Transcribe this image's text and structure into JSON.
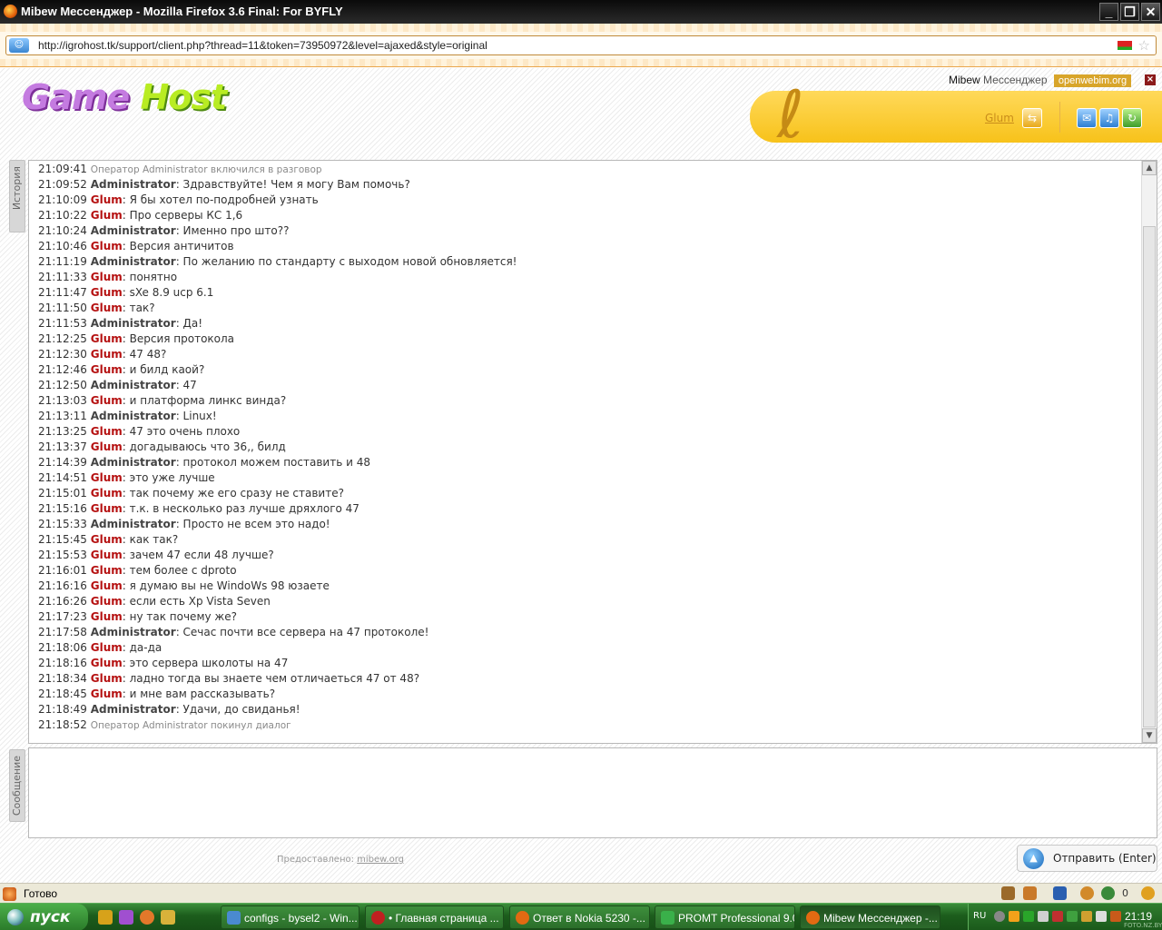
{
  "window": {
    "title": "Mibew Мессенджер - Mozilla Firefox 3.6 Final: For BYFLY",
    "url": "http://igrohost.tk/support/client.php?thread=11&token=73950972&level=ajaxed&style=original"
  },
  "header": {
    "logo_part1": "Game",
    "logo_part2": "Host",
    "product_name": "Mibew",
    "product_suffix": "Мессенджер",
    "openwebim": "openwebim.org",
    "close_symbol": "×",
    "user_link": "Glum"
  },
  "tabs": {
    "history": "История",
    "message": "Сообщение"
  },
  "chat": [
    {
      "time": "21:09:41",
      "system": "Оператор Administrator включился в разговор"
    },
    {
      "time": "21:09:52",
      "who": "Administrator",
      "kind": "op",
      "text": "Здравствуйте! Чем я могу Вам помочь?"
    },
    {
      "time": "21:10:09",
      "who": "Glum",
      "kind": "user",
      "text": "Я бы хотел по-подробней узнать"
    },
    {
      "time": "21:10:22",
      "who": "Glum",
      "kind": "user",
      "text": "Про серверы КС 1,6"
    },
    {
      "time": "21:10:24",
      "who": "Administrator",
      "kind": "op",
      "text": "Именно про што??"
    },
    {
      "time": "21:10:46",
      "who": "Glum",
      "kind": "user",
      "text": "Версия античитов"
    },
    {
      "time": "21:11:19",
      "who": "Administrator",
      "kind": "op",
      "text": "По желанию по стандарту с выходом новой обновляется!"
    },
    {
      "time": "21:11:33",
      "who": "Glum",
      "kind": "user",
      "text": "понятно"
    },
    {
      "time": "21:11:47",
      "who": "Glum",
      "kind": "user",
      "text": "sXe 8.9 ucp 6.1"
    },
    {
      "time": "21:11:50",
      "who": "Glum",
      "kind": "user",
      "text": "так?"
    },
    {
      "time": "21:11:53",
      "who": "Administrator",
      "kind": "op",
      "text": "Да!"
    },
    {
      "time": "21:12:25",
      "who": "Glum",
      "kind": "user",
      "text": "Версия протокола"
    },
    {
      "time": "21:12:30",
      "who": "Glum",
      "kind": "user",
      "text": "47 48?"
    },
    {
      "time": "21:12:46",
      "who": "Glum",
      "kind": "user",
      "text": "и билд каой?"
    },
    {
      "time": "21:12:50",
      "who": "Administrator",
      "kind": "op",
      "text": "47"
    },
    {
      "time": "21:13:03",
      "who": "Glum",
      "kind": "user",
      "text": "и платформа линкс винда?"
    },
    {
      "time": "21:13:11",
      "who": "Administrator",
      "kind": "op",
      "text": "Linux!"
    },
    {
      "time": "21:13:25",
      "who": "Glum",
      "kind": "user",
      "text": "47 это очень плохо"
    },
    {
      "time": "21:13:37",
      "who": "Glum",
      "kind": "user",
      "text": "догадываюсь что 36,, билд"
    },
    {
      "time": "21:14:39",
      "who": "Administrator",
      "kind": "op",
      "text": "протокол можем поставить и 48"
    },
    {
      "time": "21:14:51",
      "who": "Glum",
      "kind": "user",
      "text": "это уже лучше"
    },
    {
      "time": "21:15:01",
      "who": "Glum",
      "kind": "user",
      "text": "так почему же его сразу не ставите?"
    },
    {
      "time": "21:15:16",
      "who": "Glum",
      "kind": "user",
      "text": "т.к. в несколько раз лучше дряхлого 47"
    },
    {
      "time": "21:15:33",
      "who": "Administrator",
      "kind": "op",
      "text": "Просто не всем это надо!"
    },
    {
      "time": "21:15:45",
      "who": "Glum",
      "kind": "user",
      "text": "как так?"
    },
    {
      "time": "21:15:53",
      "who": "Glum",
      "kind": "user",
      "text": "зачем 47 если 48 лучше?"
    },
    {
      "time": "21:16:01",
      "who": "Glum",
      "kind": "user",
      "text": "тем более с dproto"
    },
    {
      "time": "21:16:16",
      "who": "Glum",
      "kind": "user",
      "text": "я думаю вы не WindoWs 98 юзаете"
    },
    {
      "time": "21:16:26",
      "who": "Glum",
      "kind": "user",
      "text": "если есть Xp Vista Seven"
    },
    {
      "time": "21:17:23",
      "who": "Glum",
      "kind": "user",
      "text": "ну так почему же?"
    },
    {
      "time": "21:17:58",
      "who": "Administrator",
      "kind": "op",
      "text": "Сечас почти все сервера на 47 протоколе!"
    },
    {
      "time": "21:18:06",
      "who": "Glum",
      "kind": "user",
      "text": "да-да"
    },
    {
      "time": "21:18:16",
      "who": "Glum",
      "kind": "user",
      "text": "это сервера школоты на 47"
    },
    {
      "time": "21:18:34",
      "who": "Glum",
      "kind": "user",
      "text": "ладно тогда вы знаете чем отличаеться 47 от 48?"
    },
    {
      "time": "21:18:45",
      "who": "Glum",
      "kind": "user",
      "text": "и мне вам рассказывать?"
    },
    {
      "time": "21:18:49",
      "who": "Administrator",
      "kind": "op",
      "text": "Удачи, до свиданья!"
    },
    {
      "time": "21:18:52",
      "system": "Оператор Administrator покинул диалог"
    }
  ],
  "footer": {
    "powered_label": "Предоставлено:",
    "powered_link": "mibew.org",
    "send_label": "Отправить (Enter)"
  },
  "statusbar": {
    "status": "Готово",
    "count": "0"
  },
  "taskbar": {
    "start": "пуск",
    "items": [
      "configs - bysel2 - Win...",
      "• Главная страница ...",
      "Ответ в Nokia 5230 -...",
      "PROMT Professional 9.0",
      "Mibew Мессенджер -..."
    ],
    "lang": "RU",
    "clock": "21:19",
    "watermark": "FOTO.NZ.BY"
  },
  "colors": {
    "operator": "#444444",
    "user": "#b51010",
    "accent": "#f7c21a"
  }
}
